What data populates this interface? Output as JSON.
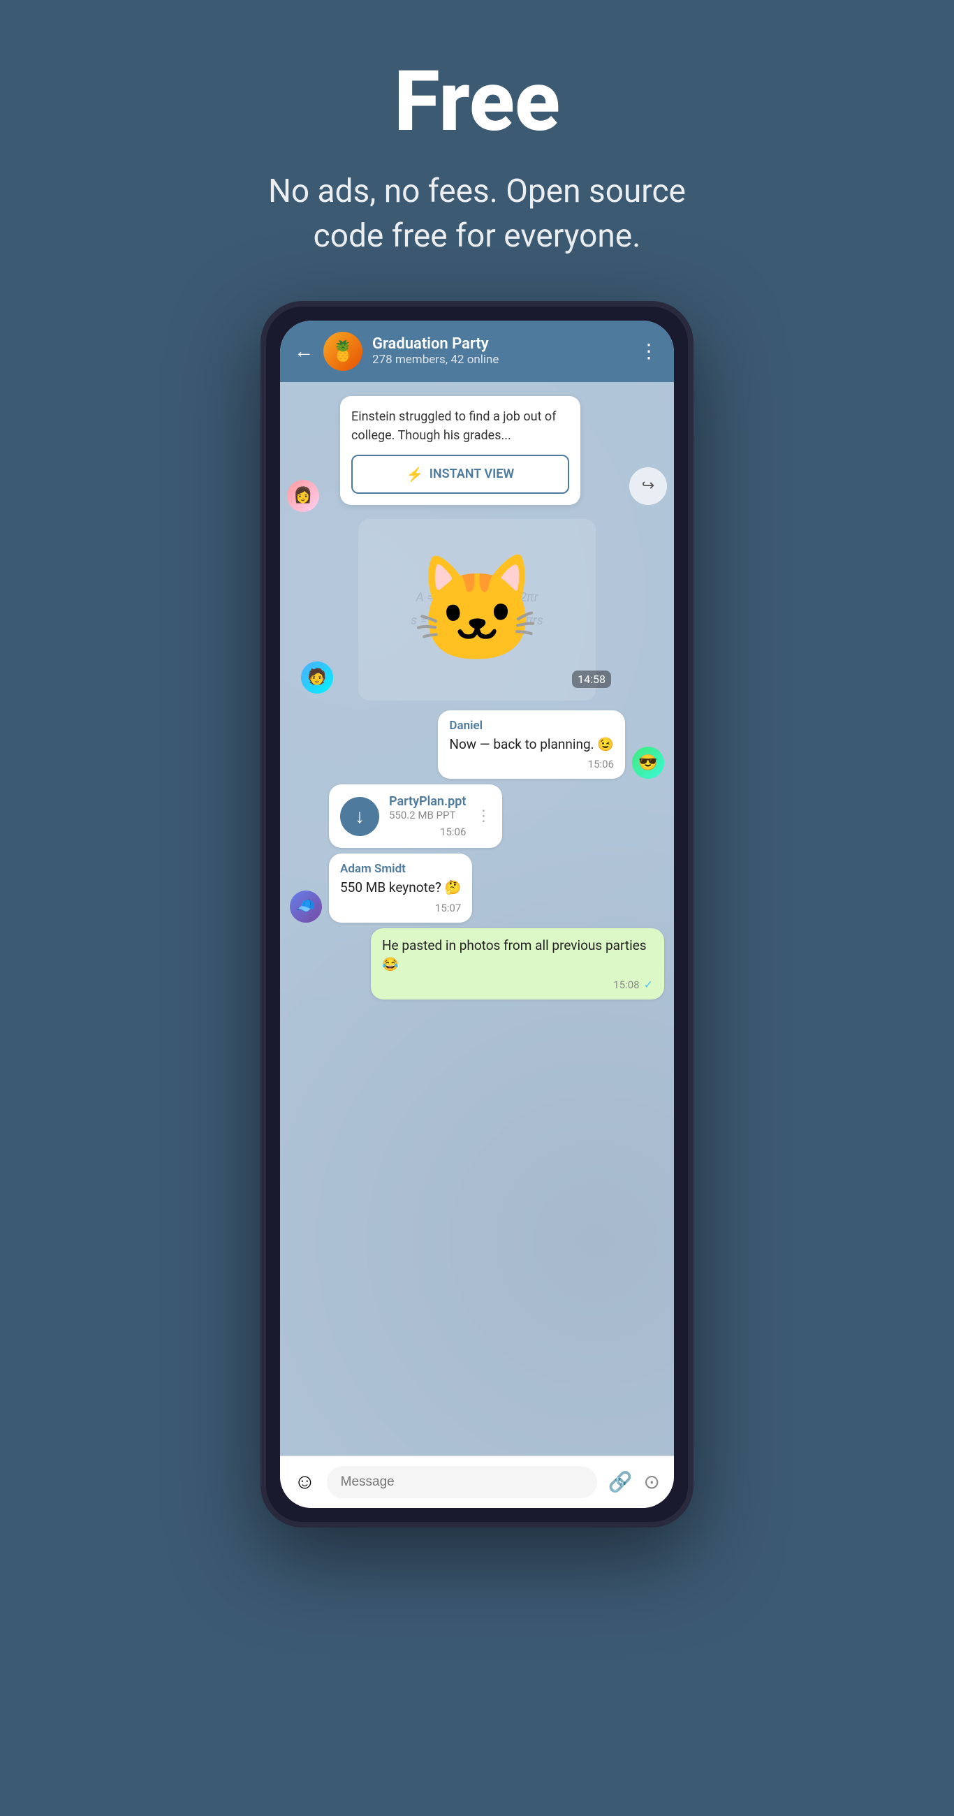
{
  "hero": {
    "title": "Free",
    "subtitle": "No ads, no fees. Open source code free for everyone."
  },
  "header": {
    "back_label": "←",
    "group_name": "Graduation Party",
    "group_members": "278 members, 42 online",
    "menu_label": "⋮",
    "group_emoji": "🍍"
  },
  "article": {
    "text": "Einstein struggled to find a job out of college. Though his grades...",
    "instant_view_label": "INSTANT VIEW",
    "iv_icon": "⚡"
  },
  "sticker": {
    "time": "14:58"
  },
  "messages": [
    {
      "id": "msg1",
      "sender": "Daniel",
      "text": "Now — back to planning. 😉",
      "time": "15:06",
      "type": "text",
      "side": "right",
      "avatar_emoji": "😎"
    },
    {
      "id": "msg2",
      "type": "file",
      "file_name": "PartyPlan.ppt",
      "file_size": "550.2 MB PPT",
      "time": "15:06",
      "menu_icon": "⋮",
      "download_icon": "↓"
    },
    {
      "id": "msg3",
      "sender": "Adam Smidt",
      "text": "550 MB keynote? 🤔",
      "time": "15:07",
      "type": "text",
      "side": "left",
      "avatar_emoji": "🧢"
    },
    {
      "id": "msg4",
      "text": "He pasted in photos from all previous parties 😂",
      "time": "15:08",
      "type": "text",
      "side": "sent",
      "check": "✓"
    }
  ],
  "input_bar": {
    "placeholder": "Message",
    "emoji_icon": "☺",
    "attachment_icon": "📎",
    "camera_icon": "⊙"
  },
  "colors": {
    "bg": "#3d5a73",
    "header_bg": "#4e7a9e",
    "chat_bg": "#b0c4d8",
    "bubble_green": "#dcf8c6",
    "sender_color": "#4e7a9e",
    "accent": "#4e7a9e"
  }
}
